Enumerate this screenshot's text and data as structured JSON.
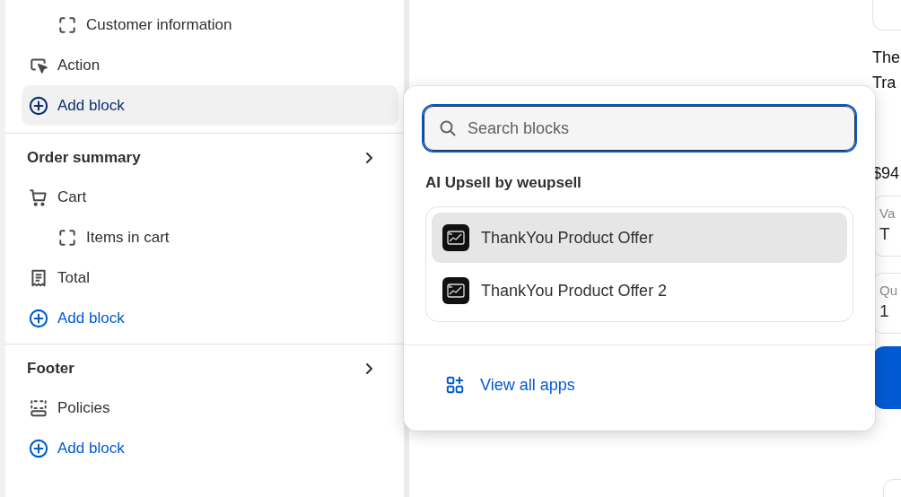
{
  "sidebar": {
    "sections": [
      {
        "items": [
          {
            "children": [
              {
                "kind": "placeholder",
                "label": "Customer information"
              }
            ]
          },
          {
            "kind": "cursor",
            "label": "Action"
          },
          {
            "kind": "add",
            "label": "Add block",
            "selected": true
          }
        ]
      },
      {
        "heading": "Order summary",
        "items": [
          {
            "kind": "cart",
            "label": "Cart",
            "children": [
              {
                "kind": "placeholder",
                "label": "Items in cart"
              }
            ]
          },
          {
            "kind": "receipt",
            "label": "Total"
          },
          {
            "kind": "add",
            "label": "Add block",
            "selected": false
          }
        ]
      },
      {
        "heading": "Footer",
        "items": [
          {
            "kind": "policies",
            "label": "Policies"
          },
          {
            "kind": "add",
            "label": "Add block",
            "selected": false
          }
        ]
      }
    ]
  },
  "popup": {
    "search": {
      "placeholder": "Search blocks"
    },
    "group_title": "AI Upsell by weupsell",
    "blocks": [
      {
        "label": "ThankYou Product Offer",
        "selected": true
      },
      {
        "label": "ThankYou Product Offer 2",
        "selected": false
      }
    ],
    "footer_link": "View all apps"
  },
  "preview": {
    "title_lines": [
      "The",
      "Tra"
    ],
    "price": "$94",
    "fields": [
      {
        "label": "Va",
        "value": "T"
      },
      {
        "label": "Qu",
        "value": "1"
      }
    ]
  }
}
